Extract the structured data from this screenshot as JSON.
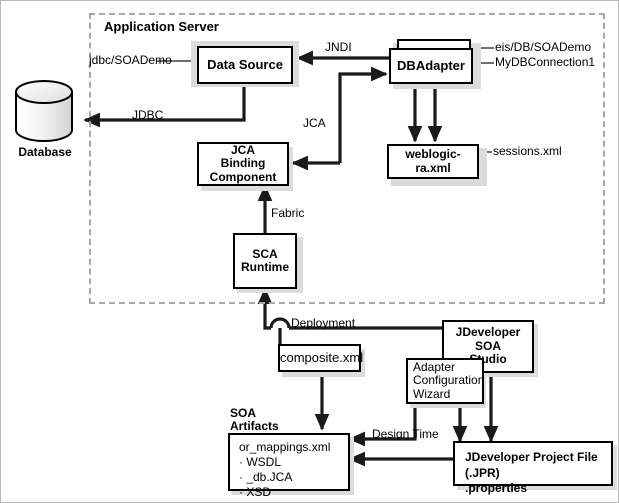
{
  "diagram": {
    "title": "Application Server",
    "region_label": "Application Server"
  },
  "nodes": {
    "database": "Database",
    "data_source": "Data Source",
    "dbadapter": "DBAdapter",
    "weblogic_ra": "weblogic-ra.xml",
    "jca_binding_component": "JCA\nBinding\nComponent",
    "jca_binding_line1": "JCA",
    "jca_binding_line2": "Binding",
    "jca_binding_line3": "Component",
    "sca_runtime_line1": "SCA",
    "sca_runtime_line2": "Runtime",
    "composite_xml": "composite.xml",
    "jdev_soa_studio_line1": "JDeveloper",
    "jdev_soa_studio_line2": "SOA",
    "jdev_soa_studio_line3": "Studio",
    "adapter_wizard_line1": "Adapter",
    "adapter_wizard_line2": "Configuration",
    "adapter_wizard_line3": "Wizard",
    "jdev_project_file_line1": "JDeveloper Project File (.JPR)",
    "jdev_project_file_line2": ".properties"
  },
  "soa_artifacts": {
    "caption_line1": "SOA",
    "caption_line2": "Artifacts",
    "items": [
      "or_mappings.xml",
      "· WSDL",
      "· _db.JCA",
      "· XSD"
    ]
  },
  "annotations": {
    "jdbc_soademo": "jdbc/SOADemo",
    "eis_db_soademo": "eis/DB/SOADemo",
    "mydbconnection1": "MyDBConnection1",
    "sessions_xml": "sessions.xml"
  },
  "edge_labels": {
    "jndi": "JNDI",
    "jdbc": "JDBC",
    "jca": "JCA",
    "fabric": "Fabric",
    "deployment": "Deployment",
    "design_time": "Design Time"
  },
  "colors": {
    "line": "#1a1a1a",
    "region_border": "#a8a8a8",
    "shadow": "#dcdcdc",
    "box_fill": "#ffffff",
    "text": "#000000"
  }
}
